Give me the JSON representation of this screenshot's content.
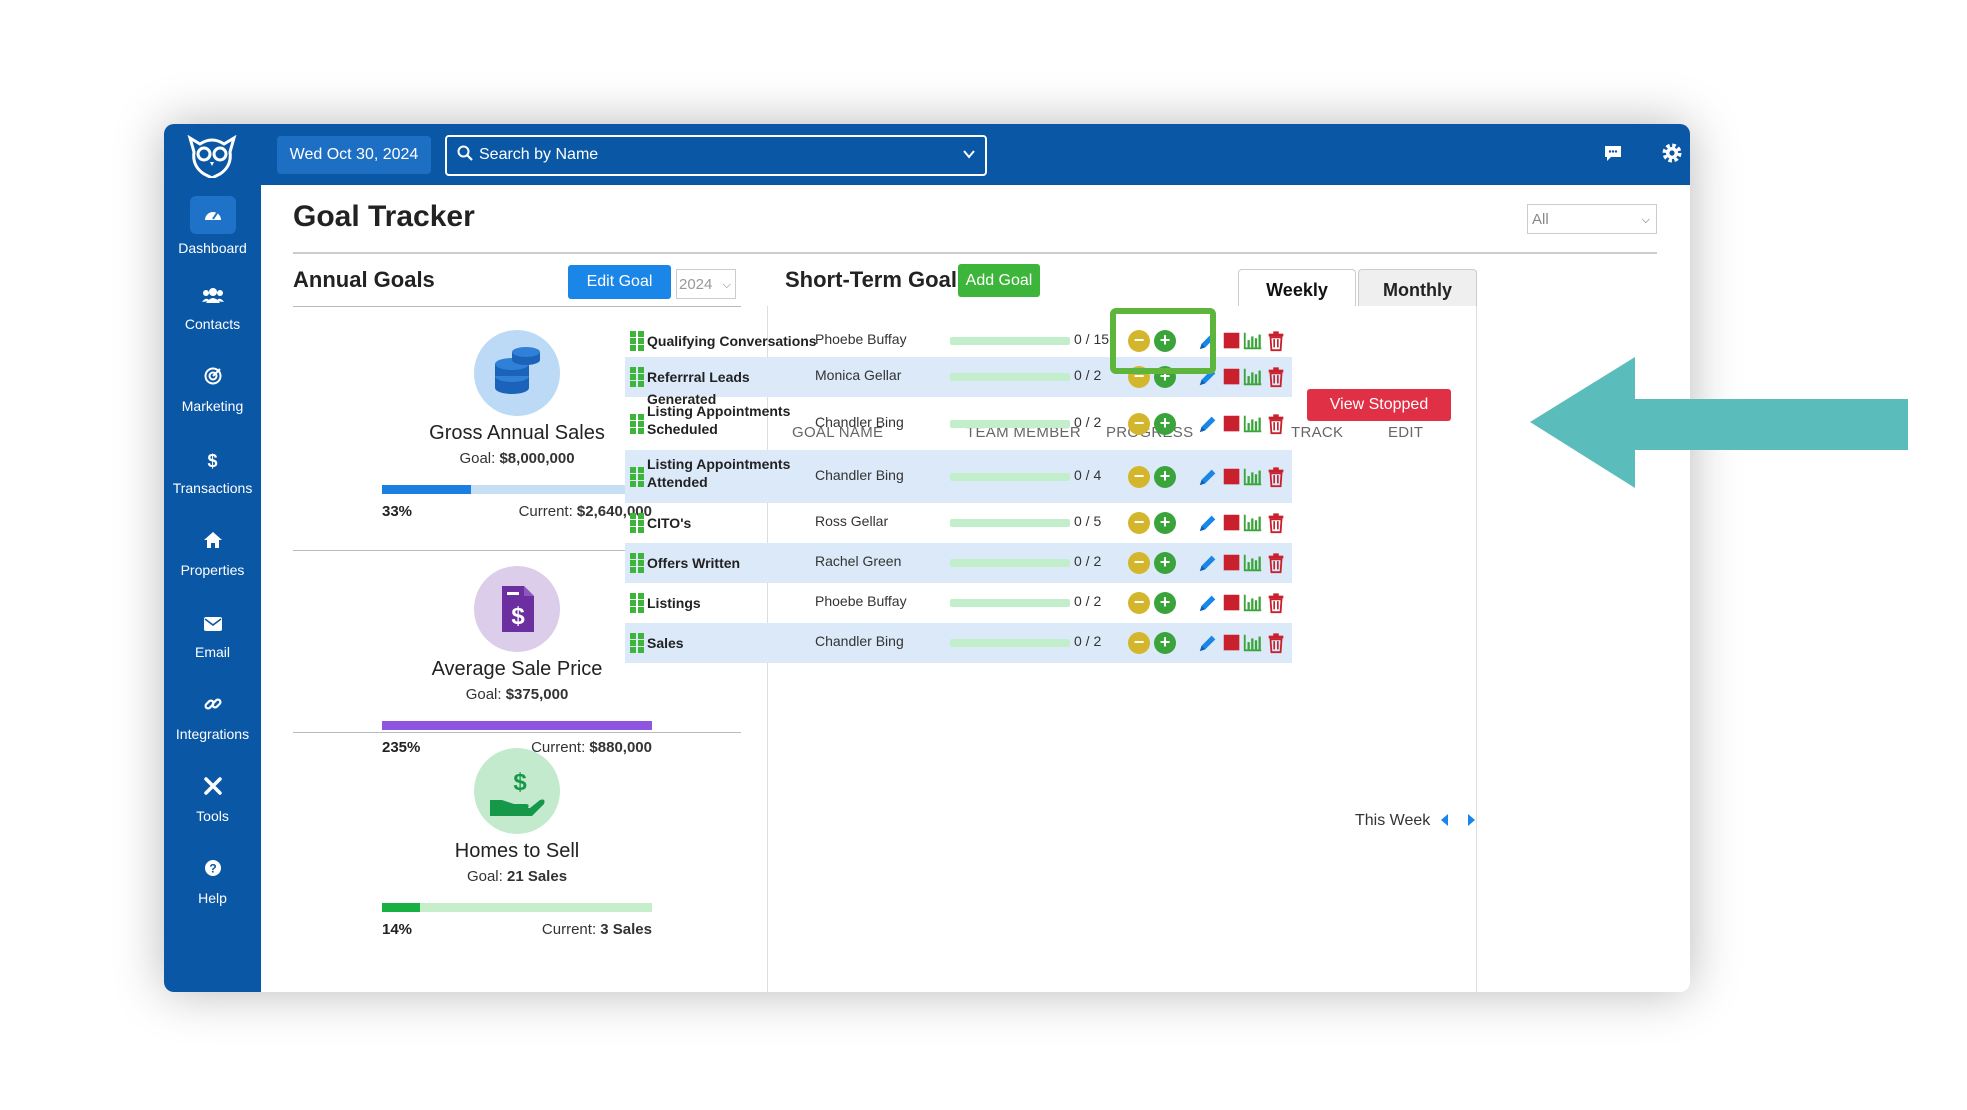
{
  "sidebar": {
    "items": [
      {
        "label": "Dashboard",
        "icon": "gauge-icon"
      },
      {
        "label": "Contacts",
        "icon": "users-icon"
      },
      {
        "label": "Marketing",
        "icon": "target-icon"
      },
      {
        "label": "Transactions",
        "icon": "dollar-icon"
      },
      {
        "label": "Properties",
        "icon": "home-icon"
      },
      {
        "label": "Email",
        "icon": "envelope-icon"
      },
      {
        "label": "Integrations",
        "icon": "link-icon"
      },
      {
        "label": "Tools",
        "icon": "tools-icon"
      },
      {
        "label": "Help",
        "icon": "question-icon"
      }
    ]
  },
  "topbar": {
    "date": "Wed Oct 30, 2024",
    "search_placeholder": "Search by Name"
  },
  "page": {
    "title": "Goal Tracker",
    "filter": "All"
  },
  "annual": {
    "title": "Annual Goals",
    "edit_label": "Edit Goal",
    "year": "2024",
    "goals": [
      {
        "name": "Gross Annual Sales",
        "goal_label": "Goal: ",
        "goal": "$8,000,000",
        "percent": "33%",
        "current_label": "Current: ",
        "current": "$2,640,000",
        "progress": 0.33,
        "color": "#1a7fe0",
        "track": "#c6dff5"
      },
      {
        "name": "Average Sale Price",
        "goal_label": "Goal: ",
        "goal": "$375,000",
        "percent": "235%",
        "current_label": "Current: ",
        "current": "$880,000",
        "progress": 1.0,
        "color": "#8d55e0",
        "track": "#ddd0f5"
      },
      {
        "name": "Homes to Sell",
        "goal_label": "Goal: ",
        "goal": "21 Sales",
        "percent": "14%",
        "current_label": "Current: ",
        "current": "3 Sales",
        "progress": 0.14,
        "color": "#18b040",
        "track": "#c7eecb"
      }
    ]
  },
  "short_term": {
    "title": "Short-Term Goals",
    "add_label": "Add Goal",
    "tabs": [
      "Weekly",
      "Monthly"
    ],
    "stopped_label": "View Stopped Goals",
    "columns": [
      "GOAL NAME",
      "TEAM MEMBER",
      "PROGRESS",
      "TRACK",
      "EDIT"
    ],
    "rows": [
      {
        "name": "Qualifying Conversations",
        "member": "Phoebe Buffay",
        "progress": "0 / 15"
      },
      {
        "name": "Referrral Leads Generated",
        "member": "Monica Gellar",
        "progress": "0 / 2"
      },
      {
        "name": "Listing Appointments Scheduled",
        "member": "Chandler Bing",
        "progress": "0 / 2"
      },
      {
        "name": "Listing Appointments Attended",
        "member": "Chandler Bing",
        "progress": "0 / 4"
      },
      {
        "name": "CITO's",
        "member": "Ross Gellar",
        "progress": "0 / 5"
      },
      {
        "name": "Offers Written",
        "member": "Rachel Green",
        "progress": "0 / 2"
      },
      {
        "name": "Listings",
        "member": "Phoebe Buffay",
        "progress": "0 / 2"
      },
      {
        "name": "Sales",
        "member": "Chandler Bing",
        "progress": "0 / 2"
      }
    ],
    "week_label": "This Week"
  },
  "colors": {
    "brand": "#0a57a5",
    "arrow": "#5bbcbc",
    "highlight": "#5db53b"
  }
}
